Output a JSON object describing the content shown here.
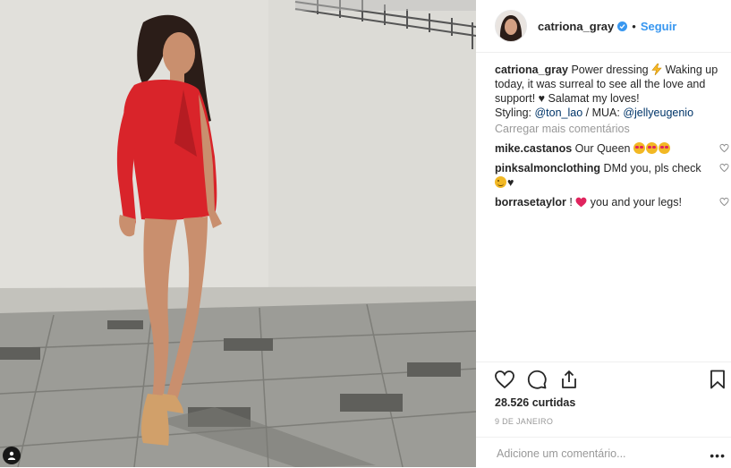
{
  "post": {
    "username": "catriona_gray",
    "follow_label": "Seguir",
    "separator": "•"
  },
  "caption": {
    "username": "catriona_gray",
    "text_1": " Power dressing ",
    "text_2": " Waking up today, it was surreal to see all the love and support! ♥ Salamat my loves!",
    "styling_label": "Styling: ",
    "mention_1": "@ton_lao",
    "mua_label": " / MUA: ",
    "mention_2": "@jellyeugenio"
  },
  "load_more_label": "Carregar mais comentários",
  "comments": [
    {
      "username": "mike.castanos",
      "text": " Our Queen "
    },
    {
      "username": "pinksalmonclothing",
      "text": " DMd you, pls check",
      "suffix": "♥"
    },
    {
      "username": "borrasetaylor",
      "text_a": " ! ",
      "text_b": " you and your legs!"
    }
  ],
  "likes_label": "28.526 curtidas",
  "date_label": "9 DE JANEIRO",
  "add_comment_placeholder": "Adicione um comentário...",
  "more_options": "•••",
  "colors": {
    "accent": "#3897f0",
    "dress": "#d9242a",
    "text": "#262626",
    "muted": "#999999"
  },
  "icons": [
    "verified-icon",
    "heart-icon",
    "comment-icon",
    "share-icon",
    "bookmark-icon",
    "user-tag-icon",
    "lightning-emoji",
    "heart-eyes-emoji",
    "wink-emoji"
  ]
}
